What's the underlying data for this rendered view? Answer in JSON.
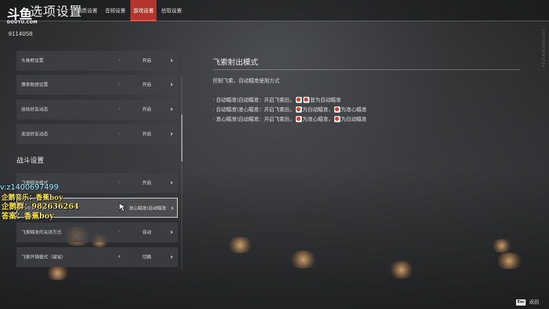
{
  "header": {
    "title": "选项设置",
    "tabs": [
      {
        "label": "画质设置",
        "active": false
      },
      {
        "label": "音频设置",
        "active": false
      },
      {
        "label": "游戏设置",
        "active": true
      },
      {
        "label": "拾取设置",
        "active": false
      }
    ]
  },
  "logo": {
    "mark": "斗鱼",
    "sub": "DOUYU.COM"
  },
  "room_id": "9114058",
  "settings": {
    "rows_top": [
      {
        "label": "头像框设置",
        "value": "开启"
      },
      {
        "label": "赛季数据设置",
        "value": "开启"
      },
      {
        "label": "接收好友动态",
        "value": "开启"
      },
      {
        "label": "发送好友动态",
        "value": "开启"
      }
    ],
    "section_title": "战斗设置",
    "rows_battle": [
      {
        "label": "飞索瞄准模式",
        "value": "开启"
      },
      {
        "label": "飞索射出模式",
        "value": "准心瞄准\\自动瞄准"
      },
      {
        "label": "飞索瞄准的关闭方式",
        "value": "自动"
      },
      {
        "label": "飞索开镜模式（键鼠）",
        "value": "切换"
      }
    ]
  },
  "description": {
    "title": "飞索射出模式",
    "subtitle": "控制飞索，自动瞄准使用方式",
    "items": [
      {
        "prefix": "· 自动瞄准\\自动瞄准：开启飞索后，",
        "suffix": "皆为自动瞄准"
      },
      {
        "prefix": "· 自动瞄准\\准心瞄准：开启飞索后，",
        "mid": "为自动瞄准，",
        "suffix": "为准心瞄准"
      },
      {
        "prefix": "· 准心瞄准\\自动瞄准：开启飞索后，",
        "mid": "为准心瞄准，",
        "suffix": "为自动瞄准"
      }
    ]
  },
  "overlay": {
    "vx": "v:z1400697499",
    "line1": "企鹅音乐：香蕉boy",
    "line2": "企鹅群：982636264",
    "line3": "答案：香蕉boy"
  },
  "vertical_code": "20210603091034",
  "footer": {
    "key": "Esc",
    "label": "返回"
  },
  "colors": {
    "active_tab": "#b4352c",
    "overlay_text": "#ffe94a",
    "overlay_vx": "#9ff4ff"
  }
}
